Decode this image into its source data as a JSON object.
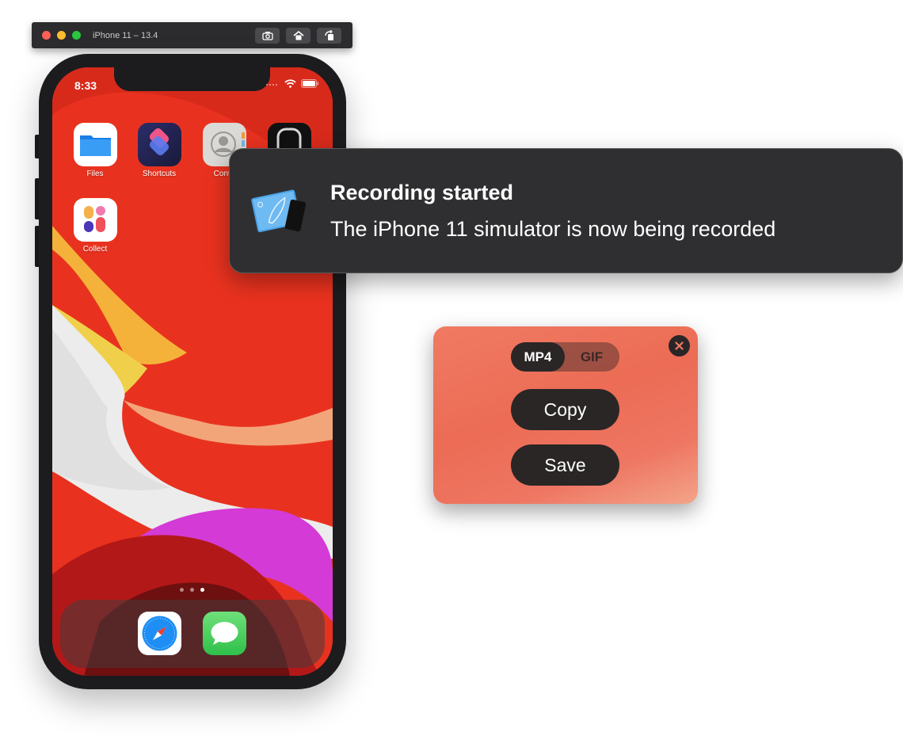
{
  "simulator": {
    "window_title": "iPhone 11 – 13.4",
    "toolbar": [
      {
        "icon": "screenshot-icon"
      },
      {
        "icon": "home-icon"
      },
      {
        "icon": "rotate-icon"
      }
    ]
  },
  "phone": {
    "status_time": "8:33",
    "home_apps": [
      {
        "label": "Files",
        "icon": "files-icon"
      },
      {
        "label": "Shortcuts",
        "icon": "shortcuts-icon"
      },
      {
        "label": "Conta",
        "icon": "contacts-icon"
      },
      {
        "label": "",
        "icon": "watch-icon"
      },
      {
        "label": "Collect",
        "icon": "collect-icon"
      }
    ],
    "page_count": 3,
    "active_page": 3,
    "dock_apps": [
      {
        "icon": "safari-icon"
      },
      {
        "icon": "messages-icon"
      }
    ]
  },
  "notification": {
    "title": "Recording started",
    "body": "The iPhone 11 simulator is now being recorded",
    "icon": "simulator-app-icon"
  },
  "export_panel": {
    "formats": [
      "MP4",
      "GIF"
    ],
    "selected_format": "MP4",
    "copy_label": "Copy",
    "save_label": "Save",
    "close_icon": "close-icon",
    "accent": "#ec6c55"
  }
}
